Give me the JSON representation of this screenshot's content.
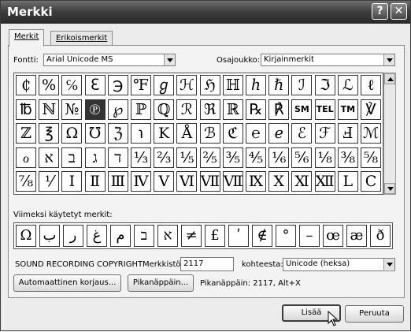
{
  "window": {
    "title": "Merkki",
    "help_glyph": "?",
    "close_glyph": "✕"
  },
  "tabs": [
    {
      "label": "Merkit"
    },
    {
      "label": "Erikoismerkit"
    }
  ],
  "font": {
    "label": "Fontti:",
    "value": "Arial Unicode MS"
  },
  "subset": {
    "label": "Osajoukko:",
    "value": "Kirjainmerkit"
  },
  "symbols": [
    [
      "₵",
      "%",
      "℅",
      "ℇ",
      "℈",
      "℉",
      "ℊ",
      "ℋ",
      "ℌ",
      "ℍ",
      "ℎ",
      "ℏ",
      "ℐ",
      "ℑ",
      "ℒ",
      "ℓ"
    ],
    [
      "℔",
      "ℕ",
      "№",
      "℗",
      "℘",
      "ℙ",
      "ℚ",
      "ℛ",
      "ℜ",
      "ℝ",
      "℞",
      "℟",
      "SM",
      "TEL",
      "TM",
      "℣"
    ],
    [
      "ℤ",
      "℥",
      "Ω",
      "℧",
      "ℨ",
      "℩",
      "K",
      "Å",
      "ℬ",
      "ℭ",
      "℮",
      "ℯ",
      "ℰ",
      "ℱ",
      "Ⅎ",
      "ℳ"
    ],
    [
      "ℴ",
      "א",
      "ב",
      "ג",
      "ד",
      "⅓",
      "⅔",
      "⅕",
      "⅖",
      "⅗",
      "⅘",
      "⅙",
      "⅚",
      "⅛",
      "⅜",
      "⅝"
    ],
    [
      "⅞",
      "⅟",
      "Ⅰ",
      "Ⅱ",
      "Ⅲ",
      "Ⅳ",
      "Ⅴ",
      "Ⅵ",
      "Ⅶ",
      "Ⅷ",
      "Ⅸ",
      "Ⅹ",
      "Ⅺ",
      "Ⅻ",
      "Ⅼ",
      "Ⅽ"
    ]
  ],
  "selected_symbol": "℗",
  "recent": {
    "label": "Viimeksi käytetyt merkit:",
    "items": [
      "Ω",
      "ب",
      "ر",
      "ﻍ",
      "م",
      "ב",
      "א",
      "≠",
      "£",
      "ʹ",
      "∉",
      "°",
      "–",
      "œ",
      "æ",
      "ð"
    ]
  },
  "char_name": "SOUND RECORDING COPYRIGHT",
  "code": {
    "label": "Merkkistö:",
    "value": "2117"
  },
  "from": {
    "label": "kohteesta:",
    "value": "Unicode (heksa)"
  },
  "buttons": {
    "autocorrect": "Automaattinen korjaus...",
    "shortcut": "Pikanäppäin...",
    "insert": "Lisää",
    "cancel": "Peruuta"
  },
  "shortcut_text": "Pikanäppäin: 2117, Alt+X"
}
